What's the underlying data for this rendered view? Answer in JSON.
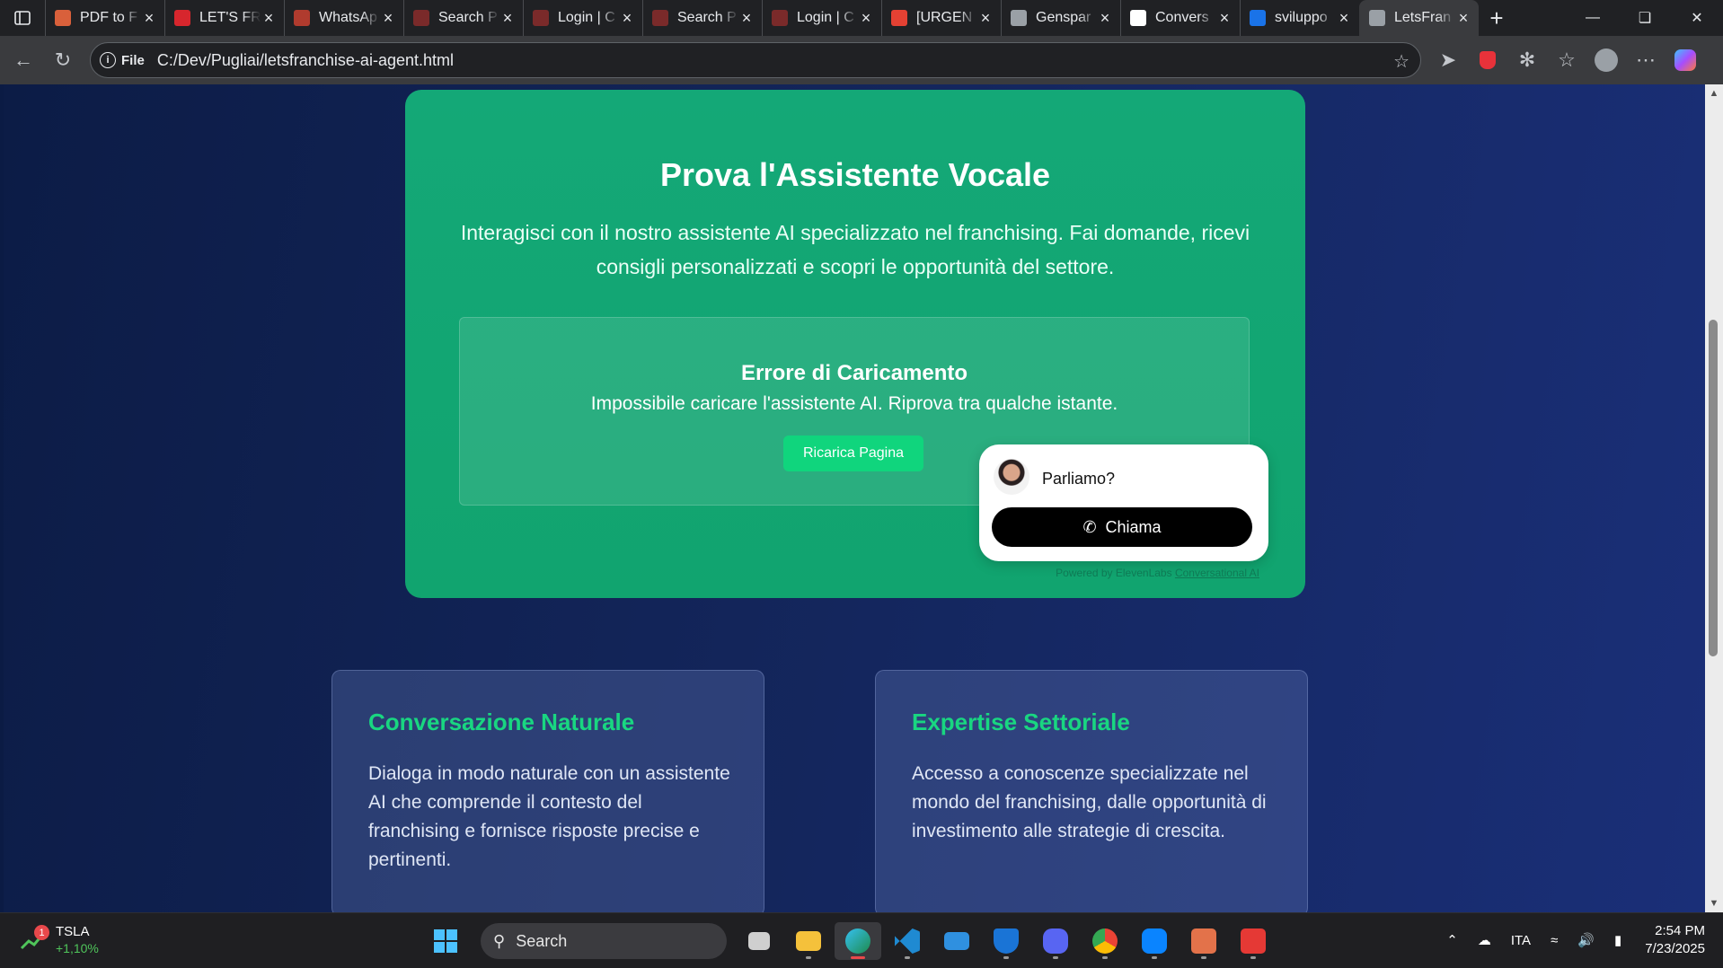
{
  "browser": {
    "tabs": [
      {
        "title": "PDF to F",
        "icon": "sparkle-icon",
        "color": "#d9603b"
      },
      {
        "title": "LET'S FR",
        "icon": "pdf-icon",
        "color": "#d7262d"
      },
      {
        "title": "WhatsAp",
        "icon": "alert-icon",
        "color": "#b03b2e"
      },
      {
        "title": "Search P",
        "icon": "site-icon",
        "color": "#7a2a2a"
      },
      {
        "title": "Login | C",
        "icon": "site-icon",
        "color": "#7a2a2a"
      },
      {
        "title": "Search P",
        "icon": "site-icon",
        "color": "#7a2a2a"
      },
      {
        "title": "Login | C",
        "icon": "site-icon",
        "color": "#7a2a2a"
      },
      {
        "title": "[URGEN",
        "icon": "gmail-icon",
        "color": "#e44133"
      },
      {
        "title": "Genspar",
        "icon": "face-icon",
        "color": "#9aa0a6"
      },
      {
        "title": "Convers",
        "icon": "pause-icon",
        "color": "#ffffff"
      },
      {
        "title": "sviluppo",
        "icon": "search-icon",
        "color": "#1a73e8"
      },
      {
        "title": "LetsFran",
        "icon": "leaf-icon",
        "color": "#9aa0a6"
      }
    ],
    "address": {
      "scheme": "File",
      "url": "C:/Dev/Pugliai/letsfranchise-ai-agent.html"
    }
  },
  "hero": {
    "title": "Prova l'Assistente Vocale",
    "subtitle": "Interagisci con il nostro assistente AI specializzato nel franchising. Fai domande, ricevi consigli personalizzati e scopri le opportunità del settore.",
    "error_title": "Errore di Caricamento",
    "error_message": "Impossibile caricare l'assistente AI. Riprova tra qualche istante.",
    "reload_label": "Ricarica Pagina"
  },
  "widget": {
    "prompt": "Parliamo?",
    "call_label": "Chiama",
    "powered_prefix": "Powered by ElevenLabs",
    "powered_link": "Conversational AI"
  },
  "features": [
    {
      "title": "Conversazione Naturale",
      "text": "Dialoga in modo naturale con un assistente AI che comprende il contesto del franchising e fornisce risposte precise e pertinenti."
    },
    {
      "title": "Expertise Settoriale",
      "text": "Accesso a conoscenze specializzate nel mondo del franchising, dalle opportunità di investimento alle strategie di crescita."
    }
  ],
  "taskbar": {
    "stock": {
      "symbol": "TSLA",
      "change": "+1,10%",
      "badge": "1"
    },
    "search_label": "Search",
    "language": "ITA",
    "time": "2:54 PM",
    "date": "7/23/2025"
  },
  "colors": {
    "accent_green": "#19d681",
    "hero_green": "#12a673",
    "page_navy": "#13255a"
  }
}
